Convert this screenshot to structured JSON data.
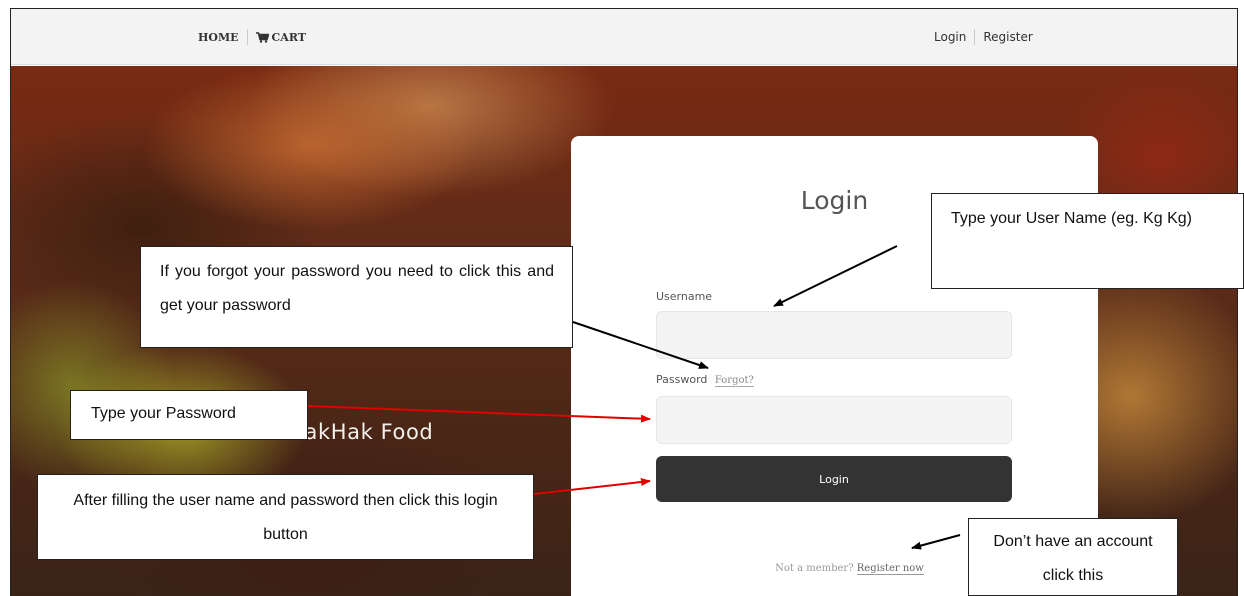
{
  "nav": {
    "home": "HOME",
    "cart": "CART",
    "cart_icon": "cart-icon",
    "login": "Login",
    "register": "Register"
  },
  "hero": {
    "welcome": "Welcome to HakHak Food"
  },
  "login_card": {
    "title": "Login",
    "username_label": "Username",
    "username_value": "",
    "password_label": "Password",
    "forgot_link": "Forgot?",
    "password_value": "",
    "login_button": "Login",
    "not_member": "Not a member?",
    "register_now": "Register now"
  },
  "callouts": {
    "username": "Type your User Name (eg. Kg Kg)",
    "forgot": "If you forgot your password you need to click this and get your password",
    "password": "Type your Password",
    "login": "After filling the user name and password then click this login button",
    "register": "Don’t have an account click this"
  },
  "colors": {
    "button": "#333333",
    "arrow_red": "#e00000",
    "arrow_black": "#000000"
  }
}
